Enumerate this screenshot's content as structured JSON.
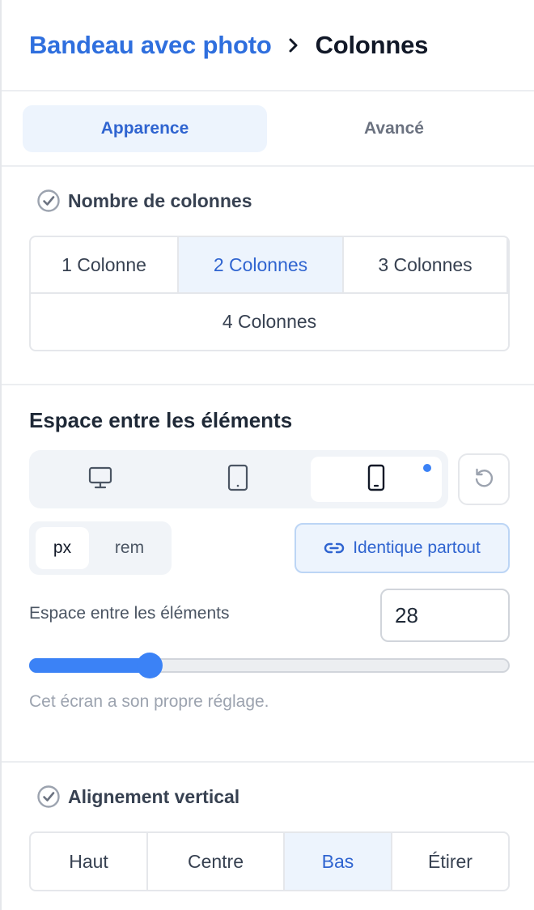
{
  "breadcrumb": {
    "parent": "Bandeau avec photo",
    "current": "Colonnes"
  },
  "tabs": [
    {
      "label": "Apparence",
      "active": true
    },
    {
      "label": "Avancé",
      "active": false
    }
  ],
  "columns": {
    "heading": "Nombre de colonnes",
    "options": [
      "1 Colonne",
      "2 Colonnes",
      "3 Colonnes",
      "4 Colonnes"
    ],
    "selected": "2 Colonnes"
  },
  "spacing": {
    "heading": "Espace entre les éléments",
    "devices": [
      "desktop-icon",
      "tablet-icon",
      "mobile-icon"
    ],
    "selected_device": "mobile",
    "units": [
      "px",
      "rem"
    ],
    "selected_unit": "px",
    "same_everywhere_label": "Identique partout",
    "field_label": "Espace entre les éléments",
    "value": "28",
    "slider_fraction": 0.25,
    "hint": "Cet écran a son propre réglage."
  },
  "alignment": {
    "heading": "Alignement vertical",
    "options": [
      "Haut",
      "Centre",
      "Bas",
      "Étirer"
    ],
    "selected": "Bas"
  },
  "colors": {
    "accent": "#3b82f6",
    "link": "#2f6fde",
    "selected_bg": "#edf4fd"
  }
}
